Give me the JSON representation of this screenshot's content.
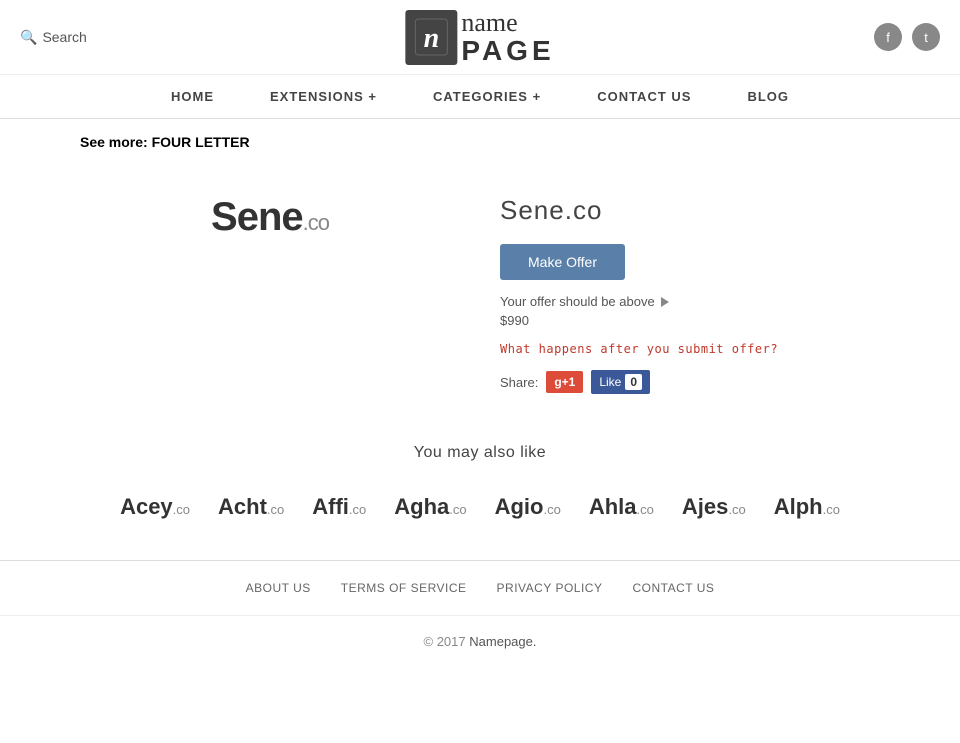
{
  "header": {
    "search_label": "Search",
    "logo_icon": "n",
    "logo_name": "name",
    "logo_page": "PAGE",
    "social": [
      {
        "name": "facebook",
        "icon": "f"
      },
      {
        "name": "twitter",
        "icon": "t"
      }
    ]
  },
  "nav": {
    "items": [
      {
        "label": "HOME",
        "key": "home"
      },
      {
        "label": "EXTENSIONS +",
        "key": "extensions"
      },
      {
        "label": "CATEGORIES +",
        "key": "categories"
      },
      {
        "label": "CONTACT US",
        "key": "contact"
      },
      {
        "label": "BLOG",
        "key": "blog"
      }
    ]
  },
  "breadcrumb": {
    "prefix": "See more:",
    "link": "FOUR LETTER"
  },
  "domain": {
    "name": "Sene",
    "ext": ".co",
    "full": "Sene.co",
    "make_offer_label": "Make Offer",
    "offer_hint": "Your offer should be above",
    "offer_amount": "$990",
    "offer_link": "What happens after you submit offer?",
    "share_label": "Share:",
    "gplus_label": "g+1",
    "fb_like_label": "Like",
    "fb_count": "0"
  },
  "also_like": {
    "title": "You may also like",
    "items": [
      {
        "name": "Acey",
        "ext": ".co"
      },
      {
        "name": "Acht",
        "ext": ".co"
      },
      {
        "name": "Affi",
        "ext": ".co"
      },
      {
        "name": "Agha",
        "ext": ".co"
      },
      {
        "name": "Agio",
        "ext": ".co"
      },
      {
        "name": "Ahla",
        "ext": ".co"
      },
      {
        "name": "Ajes",
        "ext": ".co"
      },
      {
        "name": "Alph",
        "ext": ".co"
      }
    ]
  },
  "footer": {
    "links": [
      {
        "label": "ABOUT US",
        "key": "about"
      },
      {
        "label": "TERMS OF SERVICE",
        "key": "terms"
      },
      {
        "label": "PRIVACY POLICY",
        "key": "privacy"
      },
      {
        "label": "CONTACT US",
        "key": "contact"
      }
    ],
    "copyright_prefix": "© 2017",
    "copyright_brand": "Namepage.",
    "copyright_full": "© 2017 Namepage."
  }
}
